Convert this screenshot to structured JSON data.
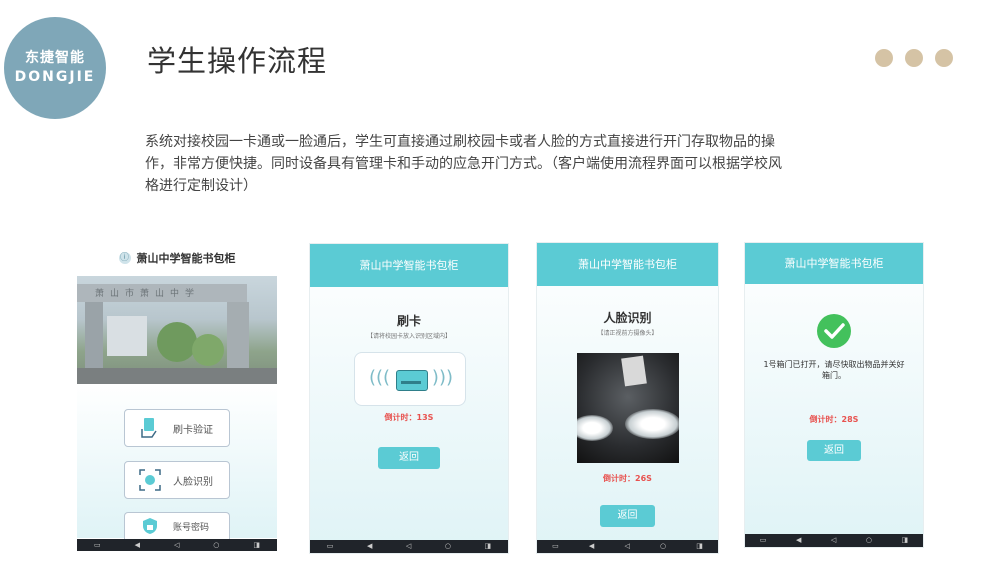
{
  "logo": {
    "cn": "东捷智能",
    "en": "DONGJIE"
  },
  "page_title": "学生操作流程",
  "description": "系统对接校园一卡通或一脸通后，学生可直接通过刷校园卡或者人脸的方式直接进行开门存取物品的操作，非常方便快捷。同时设备具有管理卡和手动的应急开门方式。（客户端使用流程界面可以根据学校风格进行定制设计）",
  "colors": {
    "accent": "#5bcbd4",
    "logo_bg": "#7fa7b8",
    "dots": "#d5c3a5",
    "countdown": "#e8524f",
    "success": "#43c15c"
  },
  "screen1": {
    "app_title": "萧山中学智能书包柜",
    "banner_sign": "萧山市萧山中学",
    "buttons": [
      {
        "label": "刷卡验证",
        "icon": "card-hand-icon"
      },
      {
        "label": "人脸识别",
        "icon": "face-scan-icon"
      },
      {
        "label": "账号密码",
        "icon": "lock-icon"
      }
    ]
  },
  "screen2": {
    "header": "萧山中学智能书包柜",
    "title": "刷卡",
    "hint": "【请将校园卡放入识别区域内】",
    "countdown": "倒计时：13S",
    "back": "返回"
  },
  "screen3": {
    "header": "萧山中学智能书包柜",
    "title": "人脸识别",
    "hint": "【请正视前方摄像头】",
    "countdown": "倒计时：26S",
    "back": "返回"
  },
  "screen4": {
    "header": "萧山中学智能书包柜",
    "message": "1号箱门已打开，请尽快取出物品并关好箱门。",
    "countdown": "倒计时：28S",
    "back": "返回"
  },
  "navbar_icons": [
    "screenshot-icon",
    "volume-icon",
    "back-icon",
    "home-icon",
    "recent-icon"
  ]
}
